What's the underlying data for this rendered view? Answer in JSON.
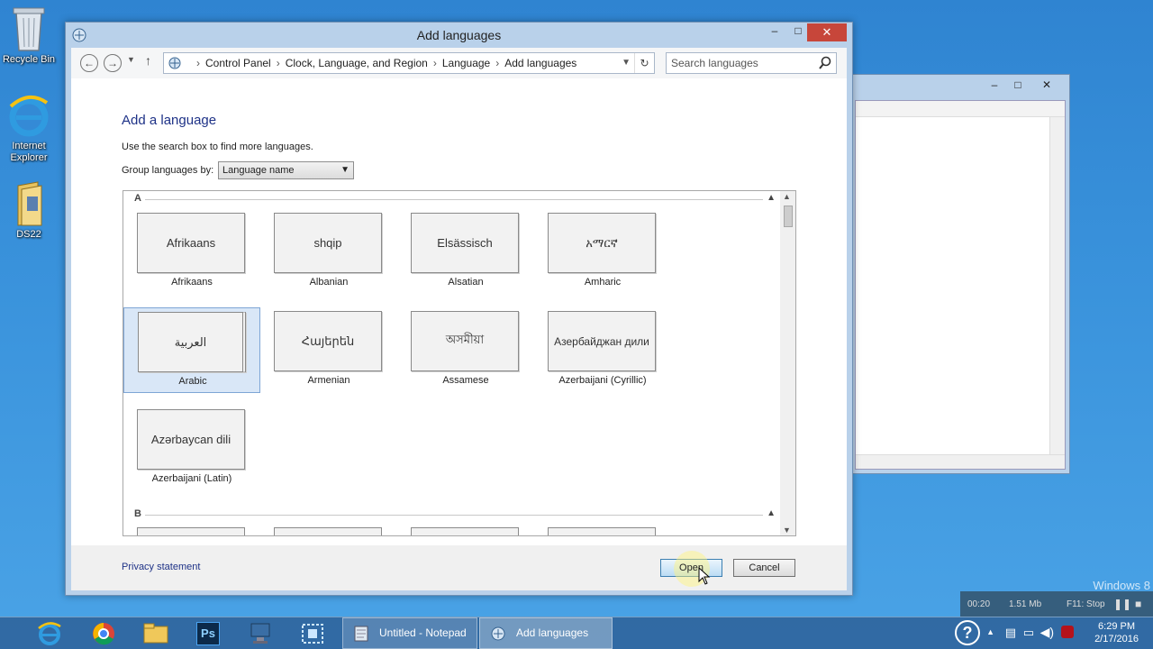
{
  "desktop": {
    "icons": [
      {
        "label": "Recycle Bin"
      },
      {
        "label": "Internet Explorer"
      },
      {
        "label": "DS22"
      }
    ],
    "watermark": "Windows 8"
  },
  "window": {
    "title": "Add languages",
    "address": {
      "crumbs": [
        "Control Panel",
        "Clock, Language, and Region",
        "Language",
        "Add languages"
      ]
    },
    "search_placeholder": "Search languages",
    "heading": "Add a language",
    "hint": "Use the search box to find more languages.",
    "group_label": "Group languages by:",
    "group_value": "Language name",
    "sections": [
      {
        "letter": "A",
        "languages": [
          {
            "native": "Afrikaans",
            "english": "Afrikaans",
            "selected": false
          },
          {
            "native": "shqip",
            "english": "Albanian",
            "selected": false
          },
          {
            "native": "Elsässisch",
            "english": "Alsatian",
            "selected": false
          },
          {
            "native": "አማርኛ",
            "english": "Amharic",
            "selected": false
          },
          {
            "native": "العربية",
            "english": "Arabic",
            "selected": true
          },
          {
            "native": "Հայերեն",
            "english": "Armenian",
            "selected": false
          },
          {
            "native": "অসমীয়া",
            "english": "Assamese",
            "selected": false
          },
          {
            "native": "Азербайджан дили",
            "english": "Azerbaijani (Cyrillic)",
            "selected": false
          },
          {
            "native": "Azərbaycan dili",
            "english": "Azerbaijani (Latin)",
            "selected": false
          }
        ]
      },
      {
        "letter": "B",
        "languages": []
      }
    ],
    "privacy_link": "Privacy statement",
    "open_label": "Open",
    "cancel_label": "Cancel"
  },
  "taskbar": {
    "tasks": [
      {
        "label": "Untitled - Notepad",
        "active": false
      },
      {
        "label": "Add languages",
        "active": true
      }
    ],
    "time": "6:29 PM",
    "date": "2/17/2016"
  },
  "recorder": {
    "elapsed": "00:20",
    "size": "1.51 Mb",
    "stop": "F11: Stop"
  },
  "colors": {
    "desktop": "#3a93dc",
    "chrome": "#b9d1ea",
    "heading": "#1e3287",
    "selection": "#d9e7f7",
    "close": "#c7463a"
  }
}
